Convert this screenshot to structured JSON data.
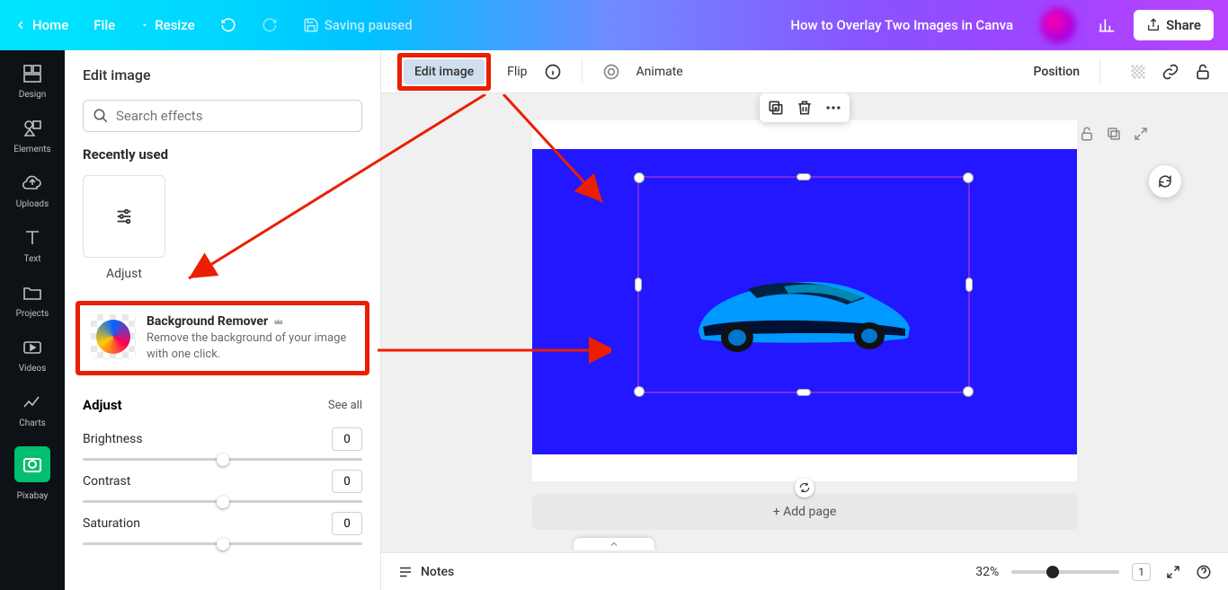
{
  "topbar": {
    "home": "Home",
    "file": "File",
    "resize": "Resize",
    "saving": "Saving paused",
    "title": "How to Overlay Two Images in Canva",
    "share": "Share"
  },
  "rail": {
    "design": "Design",
    "elements": "Elements",
    "uploads": "Uploads",
    "text": "Text",
    "projects": "Projects",
    "videos": "Videos",
    "charts": "Charts",
    "pixabay": "Pixabay"
  },
  "panel": {
    "header": "Edit image",
    "search_placeholder": "Search effects",
    "recently": "Recently used",
    "adjust_label": "Adjust",
    "bgremover_title": "Background Remover",
    "bgremover_desc": "Remove the background of your image with one click.",
    "adjust_head": "Adjust",
    "see_all": "See all",
    "brightness": "Brightness",
    "contrast": "Contrast",
    "saturation": "Saturation",
    "val_zero": "0"
  },
  "ctxbar": {
    "editimage": "Edit image",
    "flip": "Flip",
    "animate": "Animate",
    "position": "Position"
  },
  "canvas": {
    "addpage": "+ Add page"
  },
  "bottombar": {
    "notes": "Notes",
    "zoom": "32%",
    "pagecount": "1"
  }
}
